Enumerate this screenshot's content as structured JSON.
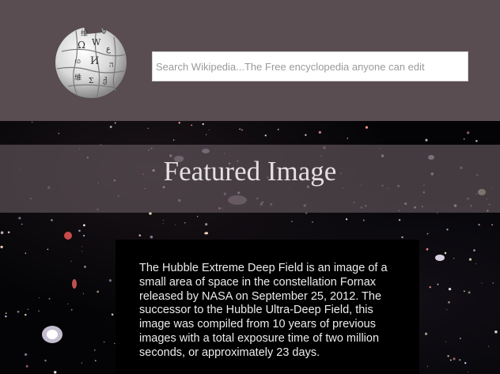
{
  "header": {
    "logo_icon": "wikipedia-globe-icon",
    "search": {
      "placeholder": "Search Wikipedia...The Free encyclopedia anyone can edit",
      "value": ""
    }
  },
  "featured": {
    "title": "Featured Image",
    "description": "The Hubble Extreme Deep Field is an image of a small area of space in the constellation Fornax released by NASA on September 25, 2012. The successor to the Hubble Ultra-Deep Field, this image was compiled from 10 years of previous images with a total exposure time of two million seconds, or approximately 23 days."
  },
  "colors": {
    "header_bg": "#594d51",
    "banner_bg": "#5c5056",
    "card_bg": "#000000",
    "space_bg": "#040406"
  }
}
